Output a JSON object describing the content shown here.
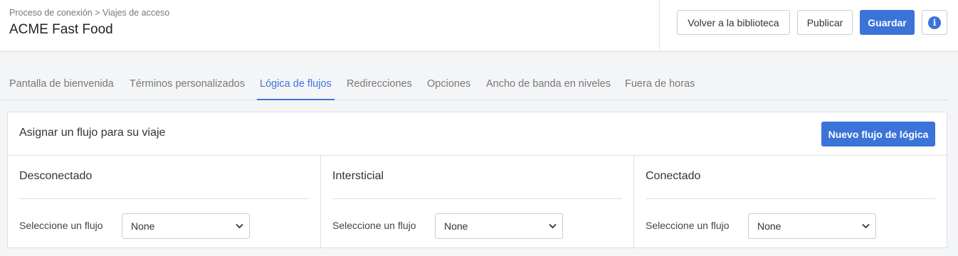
{
  "header": {
    "breadcrumb": "Proceso de conexión > Viajes de acceso",
    "title": "ACME Fast Food",
    "buttons": {
      "back": "Volver a la biblioteca",
      "publish": "Publicar",
      "save": "Guardar"
    },
    "info_icon": "info-icon"
  },
  "tabs": [
    {
      "label": "Pantalla de bienvenida",
      "active": false
    },
    {
      "label": "Términos personalizados",
      "active": false
    },
    {
      "label": "Lógica de flujos",
      "active": true
    },
    {
      "label": "Redirecciones",
      "active": false
    },
    {
      "label": "Opciones",
      "active": false
    },
    {
      "label": "Ancho de banda en niveles",
      "active": false
    },
    {
      "label": "Fuera de horas",
      "active": false
    }
  ],
  "card": {
    "title": "Asignar un flujo para su viaje",
    "new_button": "Nuevo flujo de lógica",
    "columns": [
      {
        "title": "Desconectado",
        "select_label": "Seleccione un flujo",
        "select_value": "None"
      },
      {
        "title": "Intersticial",
        "select_label": "Seleccione un flujo",
        "select_value": "None"
      },
      {
        "title": "Conectado",
        "select_label": "Seleccione un flujo",
        "select_value": "None"
      }
    ]
  },
  "colors": {
    "accent": "#3b73d9",
    "background": "#f4f5f7"
  }
}
